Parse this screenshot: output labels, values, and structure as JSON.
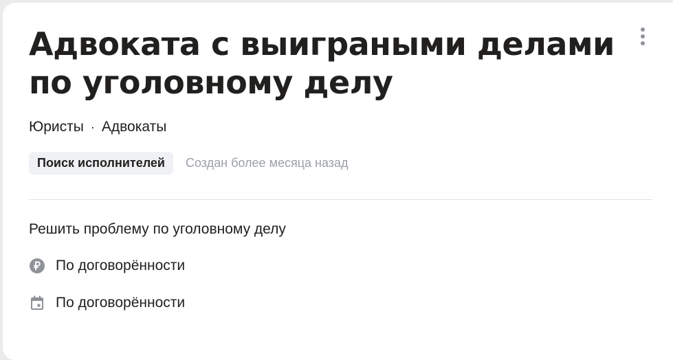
{
  "header": {
    "title": "Адвоката с выиграными делами по уголовному делу",
    "menu_icon": "more-vertical-icon"
  },
  "breadcrumb": {
    "items": [
      "Юристы",
      "Адвокаты"
    ],
    "separator": "·"
  },
  "status": {
    "badge": "Поиск исполнителей",
    "created": "Создан более месяца назад"
  },
  "description": "Решить проблему по уголовному делу",
  "details": {
    "price": {
      "icon": "ruble-icon",
      "text": "По договорённости"
    },
    "date": {
      "icon": "calendar-icon",
      "text": "По договорённости"
    }
  },
  "colors": {
    "text": "#21201f",
    "muted": "#9a9ea6",
    "icon": "#8e9399",
    "badge_bg": "#f0f1f4"
  }
}
